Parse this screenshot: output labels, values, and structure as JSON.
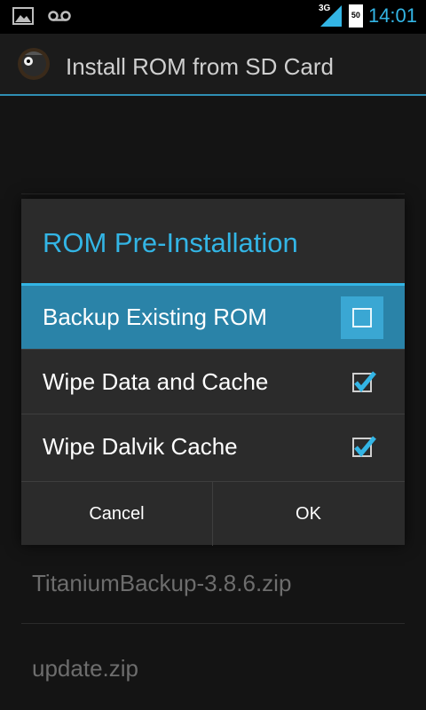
{
  "status_bar": {
    "time": "14:01",
    "network_label": "3G",
    "battery_level": "50",
    "icons": [
      "gallery-icon",
      "voicemail-icon",
      "signal-icon",
      "battery-icon"
    ]
  },
  "action_bar": {
    "title": "Install ROM from SD Card",
    "icon": "clockwork-app-icon"
  },
  "background_list": {
    "items": [
      "TitaniumBackup-3.8.6.zip",
      "update.zip"
    ]
  },
  "dialog": {
    "title": "ROM Pre-Installation",
    "options": [
      {
        "label": "Backup Existing ROM",
        "checked": false,
        "highlighted": true
      },
      {
        "label": "Wipe Data and Cache",
        "checked": true,
        "highlighted": false
      },
      {
        "label": "Wipe Dalvik Cache",
        "checked": true,
        "highlighted": false
      }
    ],
    "buttons": {
      "cancel": "Cancel",
      "ok": "OK"
    }
  },
  "colors": {
    "accent": "#33b5e5",
    "highlight_row": "#2a83a8",
    "dialog_bg": "#2b2b2b"
  }
}
